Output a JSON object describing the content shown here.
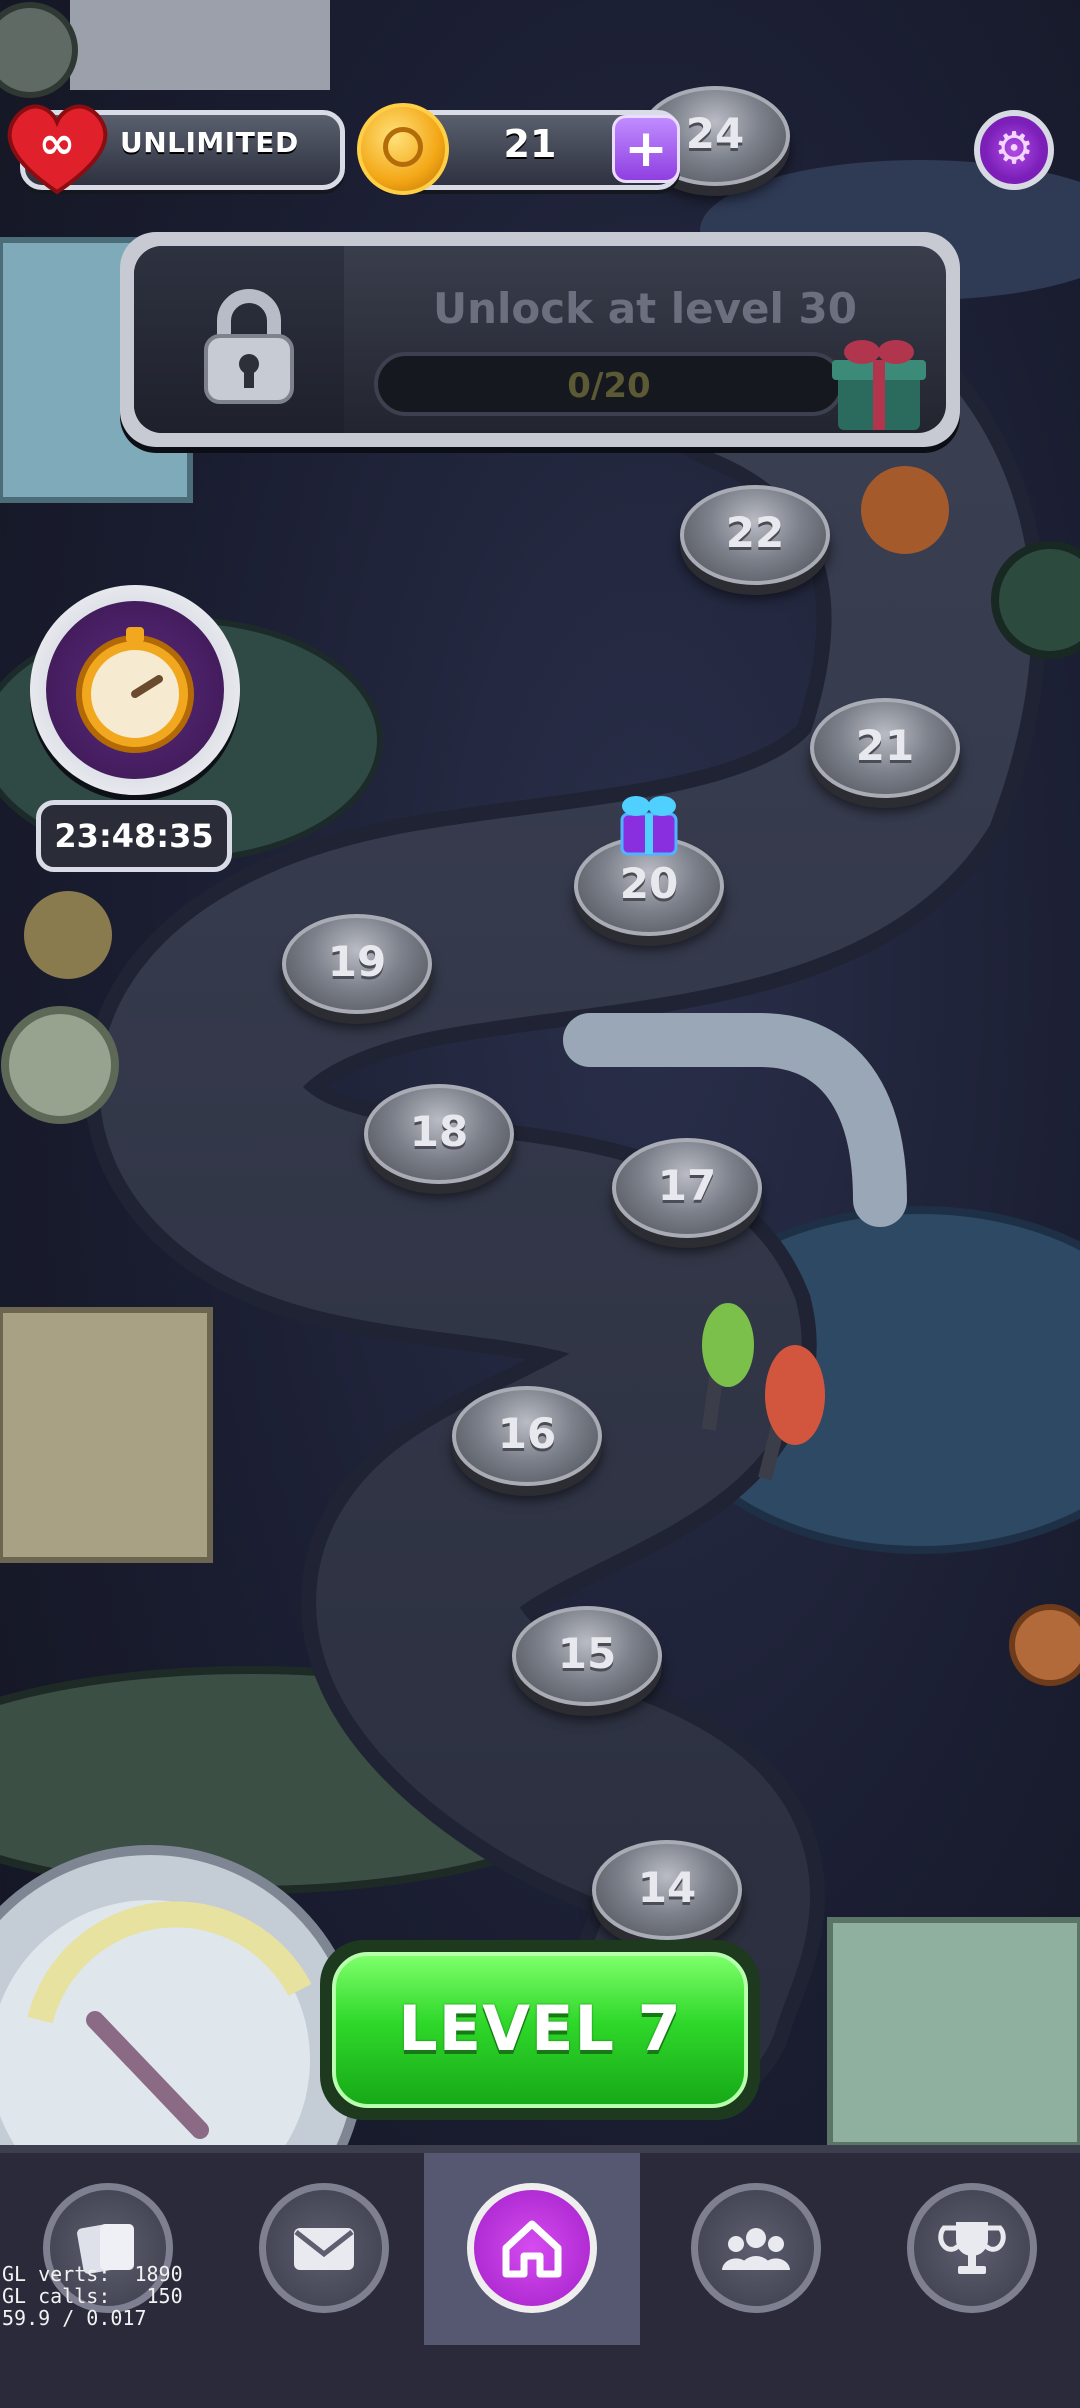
{
  "hud": {
    "lives_label": "UNLIMITED",
    "coin_count": "21",
    "plus_label": "+"
  },
  "unlock_banner": {
    "title": "Unlock at level 30",
    "progress_text": "0/20",
    "progress": 0
  },
  "timer": {
    "text": "23:48:35"
  },
  "levels": {
    "l14": "14",
    "l15": "15",
    "l16": "16",
    "l17": "17",
    "l18": "18",
    "l19": "19",
    "l20": "20",
    "l21": "21",
    "l22": "22",
    "l24": "24"
  },
  "play_button": {
    "label": "LEVEL 7"
  },
  "bottom_nav": {
    "items": [
      "cards-icon",
      "mail-icon",
      "home-icon",
      "team-icon",
      "trophy-icon"
    ],
    "active": "home-icon"
  },
  "debug": {
    "line1": "GL verts:  1890",
    "line2": "GL calls:   150",
    "line3": "59.9 / 0.017"
  },
  "colors": {
    "play_green": "#2fd82a",
    "accent_purple": "#a21fc8",
    "coin_gold": "#f3a716",
    "heart_red": "#e0202a"
  }
}
